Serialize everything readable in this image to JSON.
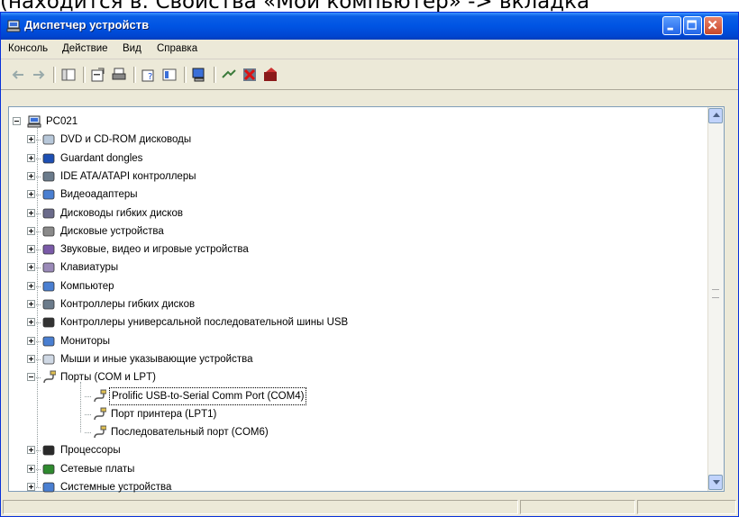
{
  "caption_fragment": "(находится в: Свойства «Мой компьютер» -> вкладка",
  "window": {
    "title": "Диспетчер устройств",
    "controls": {
      "minimize": "minimize",
      "maximize": "maximize",
      "close": "close"
    }
  },
  "menu": [
    "Консоль",
    "Действие",
    "Вид",
    "Справка"
  ],
  "toolbar_icons": [
    "back-arrow-icon",
    "forward-arrow-icon",
    "show-hide-tree-icon",
    "properties-icon",
    "print-icon",
    "help-icon",
    "view-icon",
    "scan-hardware-icon",
    "update-driver-icon",
    "uninstall-icon",
    "disable-icon"
  ],
  "tree": {
    "root": "PC021",
    "categories": [
      "DVD и CD-ROM дисководы",
      "Guardant dongles",
      "IDE ATA/ATAPI контроллеры",
      "Видеоадаптеры",
      "Дисководы гибких дисков",
      "Дисковые устройства",
      "Звуковые, видео и игровые устройства",
      "Клавиатуры",
      "Компьютер",
      "Контроллеры гибких дисков",
      "Контроллеры универсальной последовательной шины USB",
      "Мониторы",
      "Мыши и иные указывающие устройства",
      "Порты (COM и LPT)",
      "Процессоры",
      "Сетевые платы",
      "Системные устройства"
    ],
    "ports_children": [
      "Prolific USB-to-Serial Comm Port (COM4)",
      "Порт принтера (LPT1)",
      "Последовательный порт (COM6)"
    ],
    "selected": "Prolific USB-to-Serial Comm Port (COM4)"
  }
}
